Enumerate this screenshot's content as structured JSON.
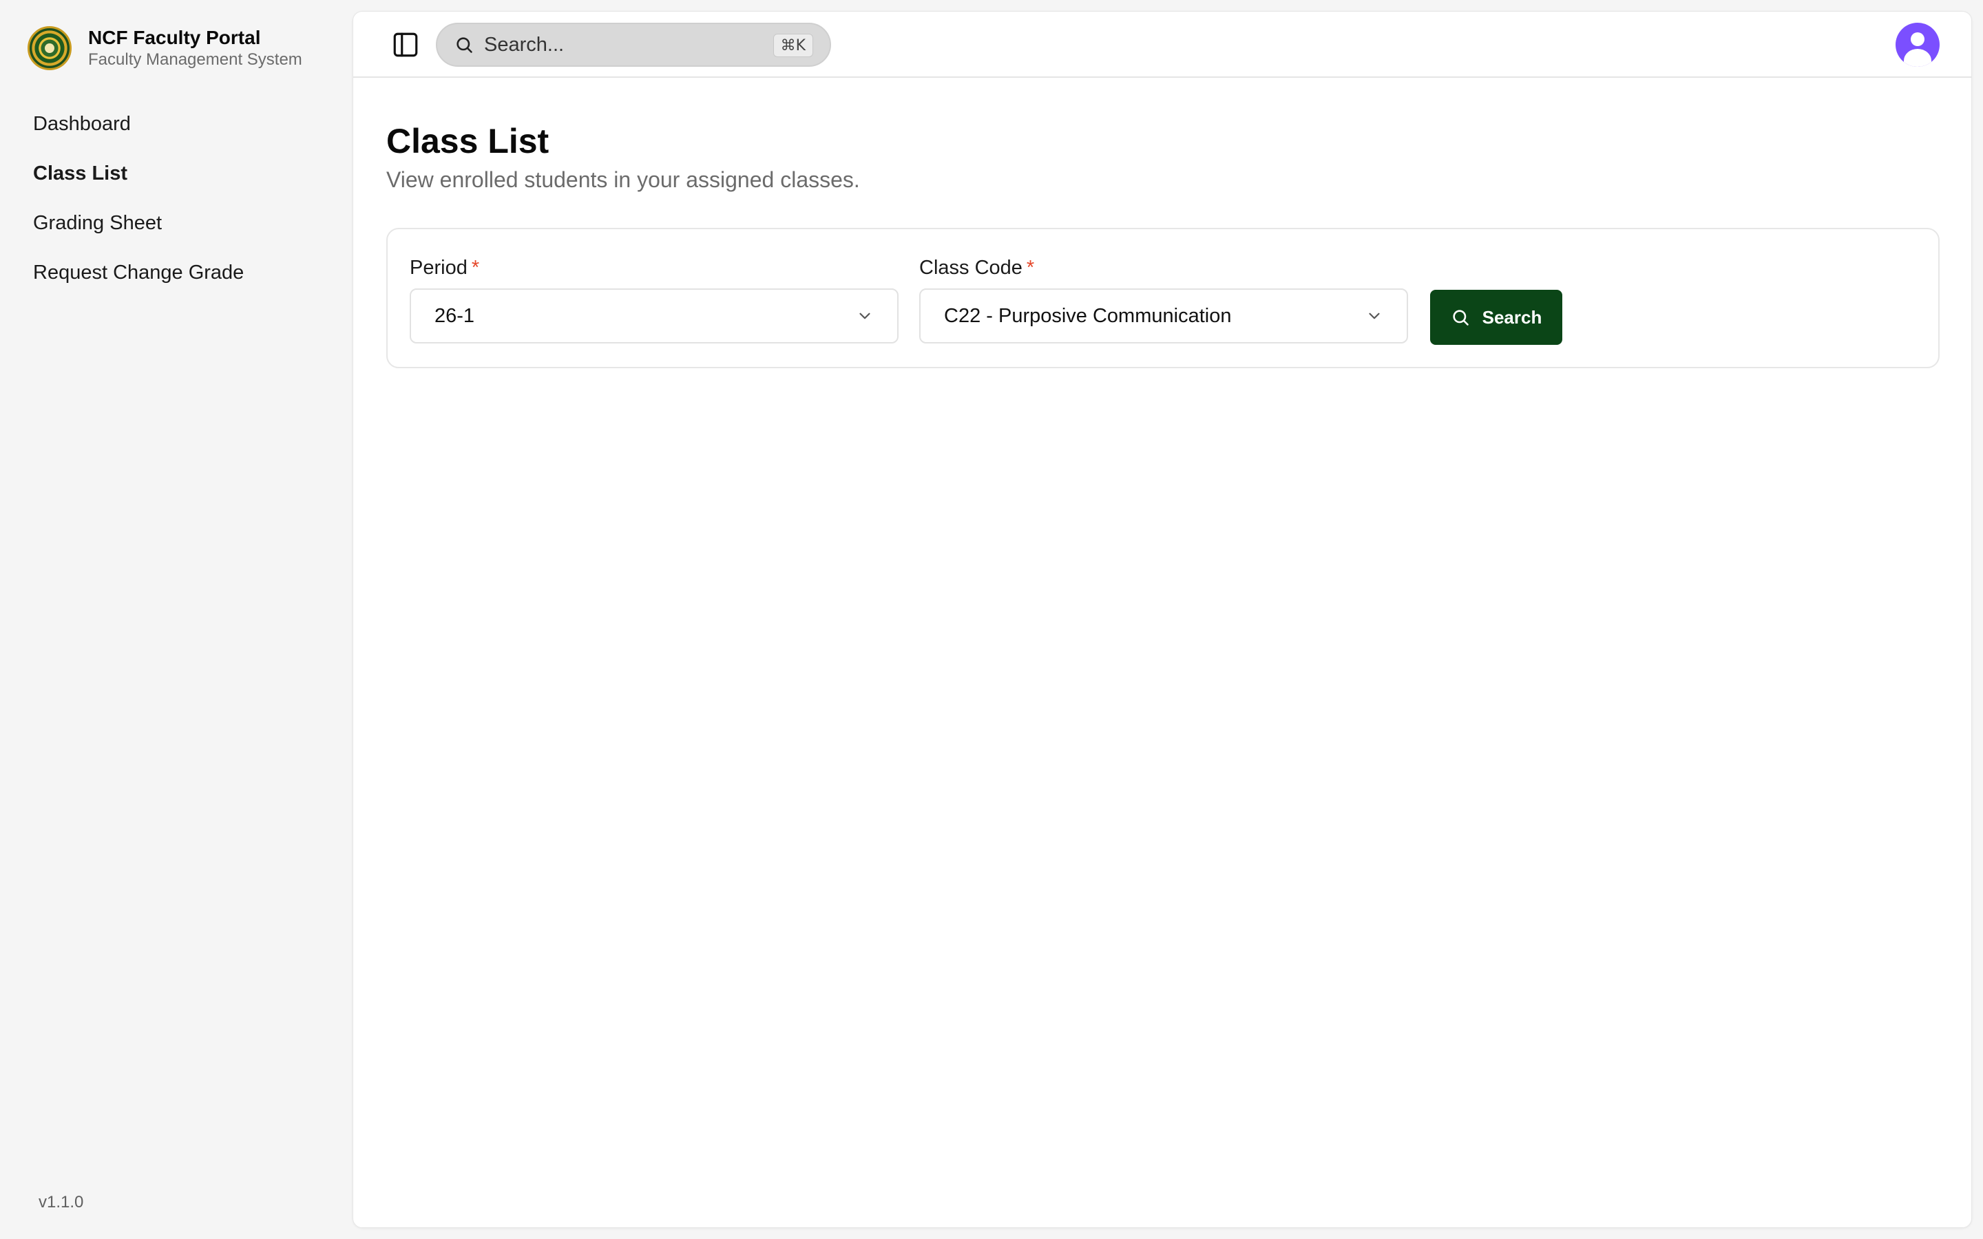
{
  "sidebar": {
    "brand_title": "NCF Faculty Portal",
    "brand_subtitle": "Faculty Management System",
    "items": [
      {
        "label": "Dashboard"
      },
      {
        "label": "Class List",
        "active": true
      },
      {
        "label": "Grading Sheet"
      },
      {
        "label": "Request Change Grade"
      }
    ],
    "version": "v1.1.0"
  },
  "topbar": {
    "search_placeholder": "Search...",
    "shortcut": "⌘K"
  },
  "page": {
    "title": "Class List",
    "subtitle": "View enrolled students in your assigned classes."
  },
  "filters": {
    "period_label": "Period",
    "period_value": "26-1",
    "class_code_label": "Class Code",
    "class_code_value": "C22 - Purposive Communication",
    "required_marker": "*",
    "search_button": "Search"
  },
  "colors": {
    "accent": "#0b4517",
    "required": "#e5482b",
    "avatar": "#7b4fff"
  },
  "icons": [
    "logo-icon",
    "sidebar-toggle-icon",
    "search-icon",
    "chevron-down-icon",
    "user-avatar-icon"
  ]
}
